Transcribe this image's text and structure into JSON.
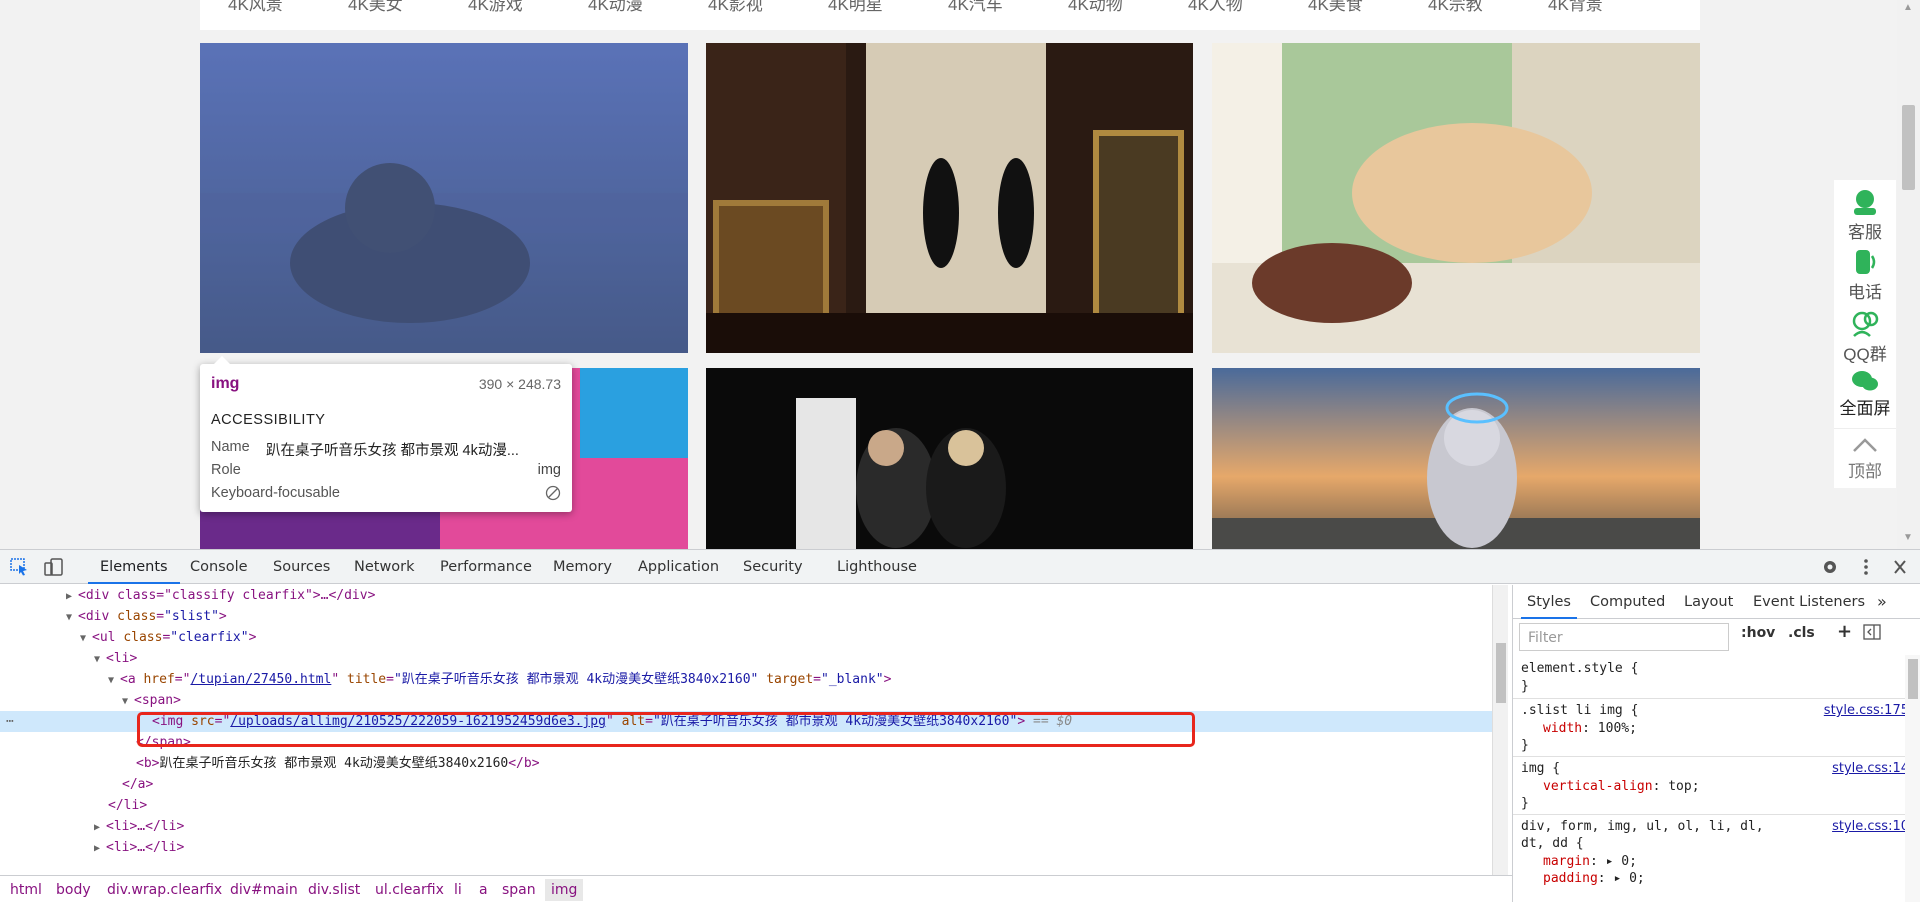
{
  "site": {
    "nav": [
      "4K风景",
      "4K美女",
      "4K游戏",
      "4K动漫",
      "4K影视",
      "4K明星",
      "4K汽车",
      "4K动物",
      "4K人物",
      "4K美食",
      "4K宗教",
      "4K背景"
    ],
    "float_menu": [
      {
        "label": "客服",
        "icon": "customer-service-icon"
      },
      {
        "label": "电话",
        "icon": "phone-icon"
      },
      {
        "label": "QQ群",
        "icon": "qq-group-icon"
      },
      {
        "label": "全面屏",
        "icon": "wechat-icon"
      },
      {
        "label": "顶部",
        "icon": "chevron-up-icon"
      }
    ]
  },
  "tooltip": {
    "tag": "img",
    "size": "390 × 248.73",
    "section": "ACCESSIBILITY",
    "rows": [
      {
        "label": "Name",
        "value": "趴在桌子听音乐女孩 都市景观 4k动漫..."
      },
      {
        "label": "Role",
        "value": "img"
      },
      {
        "label": "Keyboard-focusable",
        "value": ""
      }
    ]
  },
  "devtools": {
    "tabs": [
      "Elements",
      "Console",
      "Sources",
      "Network",
      "Performance",
      "Memory",
      "Application",
      "Security",
      "Lighthouse"
    ],
    "dom": {
      "classify_tag": "<div class=\"classify clearfix\">…</div>",
      "slist_div": "div",
      "slist_attr": "class",
      "slist_val": "\"slist\"",
      "ul_attr": "class",
      "ul_val": "\"clearfix\"",
      "li": "li",
      "a_href": "/tupian/27450.html",
      "a_title": "\"趴在桌子听音乐女孩 都市景观 4k动漫美女壁纸3840x2160\"",
      "a_target": "\"_blank\"",
      "span": "span",
      "img_src": "/uploads/allimg/210525/222059-1621952459d6e3.jpg",
      "img_alt": "\"趴在桌子听音乐女孩 都市景观 4k动漫美女壁纸3840x2160\"",
      "img_marker": "== $0",
      "b_text": "趴在桌子听音乐女孩 都市景观 4k动漫美女壁纸3840x2160",
      "li_collapsed": "<li>…</li>"
    },
    "breadcrumbs": [
      "html",
      "body",
      "div.wrap.clearfix",
      "div#main",
      "div.slist",
      "ul.clearfix",
      "li",
      "a",
      "span",
      "img"
    ],
    "styles_tabs": [
      "Styles",
      "Computed",
      "Layout",
      "Event Listeners"
    ],
    "filter_placeholder": "Filter",
    "hov": ":hov",
    "cls": ".cls",
    "rules": [
      {
        "selector": "element.style {",
        "source": "",
        "props": []
      },
      {
        "selector": ".slist li img {",
        "source": "style.css:175",
        "props": [
          {
            "name": "width",
            "value": "100%;"
          }
        ]
      },
      {
        "selector": "img {",
        "source": "style.css:14",
        "props": [
          {
            "name": "vertical-align",
            "value": "top;"
          }
        ]
      },
      {
        "selector": "div, form, img, ul, ol, li, dl,",
        "source": "style.css:10",
        "selector2": "dt, dd {",
        "props": [
          {
            "name": "margin",
            "value": "▸ 0;"
          },
          {
            "name": "padding",
            "value": "▸ 0;"
          }
        ]
      }
    ]
  },
  "colors": {
    "accent": "#1a73e8",
    "highlight": "#e8261c",
    "float_icon": "#2fb35a"
  }
}
